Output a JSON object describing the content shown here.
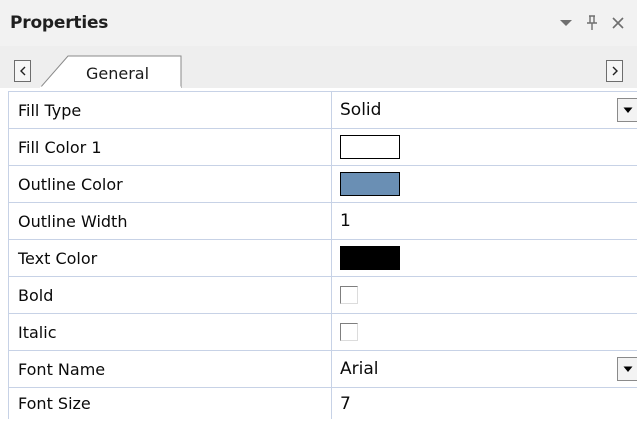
{
  "panel": {
    "title": "Properties",
    "title_icons": [
      "chevron-down-icon",
      "pin-icon",
      "close-icon"
    ]
  },
  "tabs": {
    "active_label": "General"
  },
  "properties": [
    {
      "name": "Fill Type",
      "value": "Solid",
      "kind": "dropdown"
    },
    {
      "name": "Fill Color 1",
      "color": "#ffffff",
      "kind": "color"
    },
    {
      "name": "Outline Color",
      "color": "#6a8fb4",
      "kind": "color"
    },
    {
      "name": "Outline Width",
      "value": "1",
      "kind": "text"
    },
    {
      "name": "Text Color",
      "color": "#000000",
      "kind": "color"
    },
    {
      "name": "Bold",
      "checked": false,
      "kind": "checkbox"
    },
    {
      "name": "Italic",
      "checked": false,
      "kind": "checkbox"
    },
    {
      "name": "Font Name",
      "value": "Arial",
      "kind": "dropdown"
    },
    {
      "name": "Font Size",
      "value": "7",
      "kind": "text"
    }
  ],
  "colors": {
    "grid_line": "#c7d2e6",
    "titlebar_bg": "#f2f2f2",
    "tabstrip_bg": "#eeeeee"
  }
}
